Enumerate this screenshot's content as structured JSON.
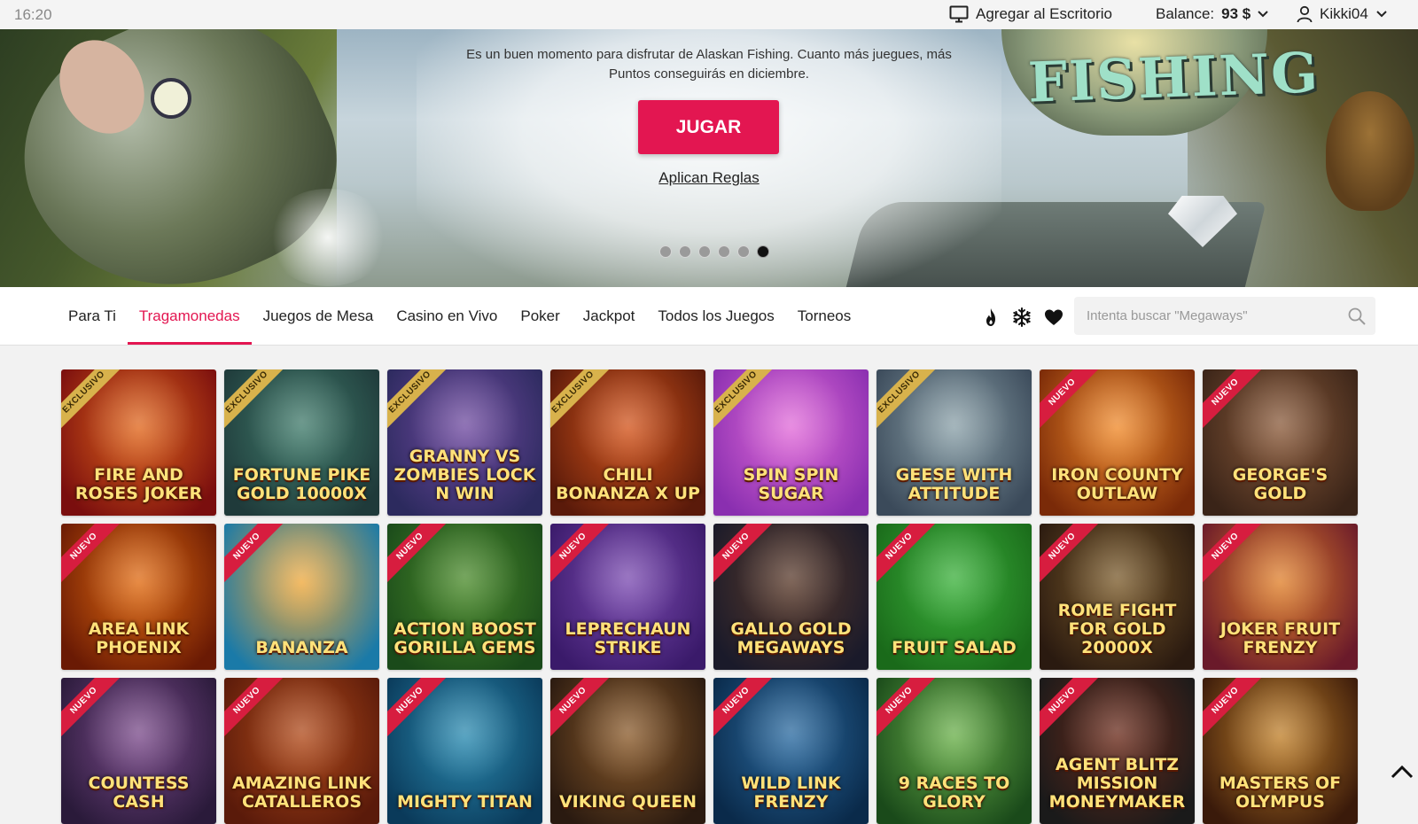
{
  "status_bar": {
    "time": "16:20",
    "desktop_label": "Agregar al Escritorio",
    "balance_label": "Balance:",
    "balance_value": "93 $",
    "username": "Kikki04"
  },
  "hero": {
    "promo_text": "Es un buen momento para disfrutar de Alaskan Fishing. Cuanto más juegues, más Puntos conseguirás en diciembre.",
    "logo_text": "FISHING",
    "play_button": "JUGAR",
    "rules_link": "Aplican Reglas",
    "slide_count": 6,
    "active_slide": 6
  },
  "nav": {
    "tabs": [
      {
        "label": "Para Ti",
        "active": false
      },
      {
        "label": "Tragamonedas",
        "active": true
      },
      {
        "label": "Juegos de Mesa",
        "active": false
      },
      {
        "label": "Casino en Vivo",
        "active": false
      },
      {
        "label": "Poker",
        "active": false
      },
      {
        "label": "Jackpot",
        "active": false
      },
      {
        "label": "Todos los Juegos",
        "active": false
      },
      {
        "label": "Torneos",
        "active": false
      }
    ],
    "icons": [
      "fire-icon",
      "snowflake-icon",
      "heart-icon"
    ],
    "search_placeholder": "Intenta buscar \"Megaways\""
  },
  "colors": {
    "accent": "#e31651"
  },
  "games": [
    {
      "title": "Fire and Roses Joker",
      "badge": "EXCLUSIVO",
      "colors": [
        "#7a0e0e",
        "#e0661b"
      ]
    },
    {
      "title": "Fortune Pike Gold 10000X",
      "badge": "EXCLUSIVO",
      "colors": [
        "#1f3a3a",
        "#3f7a6a"
      ]
    },
    {
      "title": "Granny vs Zombies Lock n Win",
      "badge": "EXCLUSIVO",
      "colors": [
        "#2c2a5e",
        "#6f4aa0"
      ]
    },
    {
      "title": "Chili Bonanza X Up",
      "badge": "EXCLUSIVO",
      "colors": [
        "#5a1a0a",
        "#d3541b"
      ]
    },
    {
      "title": "Spin Spin Sugar",
      "badge": "EXCLUSIVO",
      "colors": [
        "#8a2fb0",
        "#e16bd8"
      ]
    },
    {
      "title": "Geese with Attitude",
      "badge": "EXCLUSIVO",
      "colors": [
        "#3b4a5a",
        "#8aa0a8"
      ]
    },
    {
      "title": "Iron County Outlaw",
      "badge": "NUEVO",
      "colors": [
        "#7a2a08",
        "#f08a2a"
      ]
    },
    {
      "title": "George's Gold",
      "badge": "NUEVO",
      "colors": [
        "#3a2418",
        "#8a5a3a"
      ]
    },
    {
      "title": "Area Link Phoenix",
      "badge": "NUEVO",
      "colors": [
        "#6a1a04",
        "#e06a10"
      ]
    },
    {
      "title": "Bananza",
      "badge": "NUEVO",
      "colors": [
        "#1a7aa8",
        "#f0a83a"
      ]
    },
    {
      "title": "Action Boost Gorilla Gems",
      "badge": "NUEVO",
      "colors": [
        "#1a4a1a",
        "#4a8a2a"
      ]
    },
    {
      "title": "Leprechaun Strike",
      "badge": "NUEVO",
      "colors": [
        "#3a1a6a",
        "#7a4ab0"
      ]
    },
    {
      "title": "Gallo Gold Megaways",
      "badge": "NUEVO",
      "colors": [
        "#1a1a2a",
        "#5a3a2a"
      ]
    },
    {
      "title": "Fruit Salad",
      "badge": "NUEVO",
      "colors": [
        "#1a6a1a",
        "#3ab03a"
      ]
    },
    {
      "title": "Rome Fight for Gold 20000X",
      "badge": "NUEVO",
      "colors": [
        "#2a1a10",
        "#7a5a2a"
      ]
    },
    {
      "title": "Joker Fruit Frenzy",
      "badge": "NUEVO",
      "colors": [
        "#6a1a2a",
        "#e0802a"
      ]
    },
    {
      "title": "Countess Cash",
      "badge": "NUEVO",
      "colors": [
        "#2a1a3a",
        "#7a4a8a"
      ]
    },
    {
      "title": "Amazing Link Catalleros",
      "badge": "NUEVO",
      "colors": [
        "#5a1a0a",
        "#b04a1a"
      ]
    },
    {
      "title": "Mighty Titan",
      "badge": "NUEVO",
      "colors": [
        "#0a3a5a",
        "#2a8ab0"
      ]
    },
    {
      "title": "Viking Queen",
      "badge": "NUEVO",
      "colors": [
        "#2a1a10",
        "#8a5a2a"
      ]
    },
    {
      "title": "Wild Link Frenzy",
      "badge": "NUEVO",
      "colors": [
        "#0a2a4a",
        "#2a6aa0"
      ]
    },
    {
      "title": "9 Races to Glory",
      "badge": "NUEVO",
      "colors": [
        "#1a4a1a",
        "#6ab04a"
      ]
    },
    {
      "title": "Agent Blitz Mission Moneymaker",
      "badge": "NUEVO",
      "colors": [
        "#1a1a1a",
        "#6a2a1a"
      ]
    },
    {
      "title": "Masters of Olympus",
      "badge": "NUEVO",
      "colors": [
        "#3a1a0a",
        "#c0802a"
      ]
    }
  ]
}
